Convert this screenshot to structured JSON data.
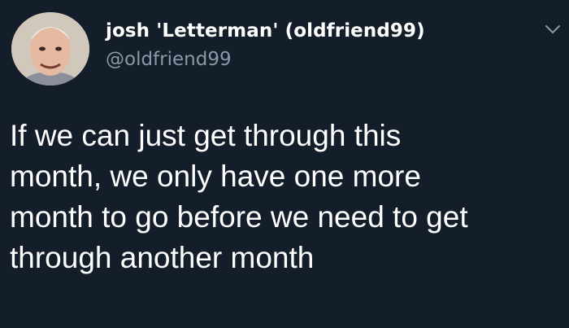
{
  "author": {
    "display_name": "josh 'Letterman' (oldfriend99)",
    "handle": "@oldfriend99",
    "avatar_icon": "profile-photo"
  },
  "menu_icon": "chevron-down-icon",
  "tweet": {
    "lines": [
      "If we can just get through this",
      "month, we only have one more",
      "month to go before we need to get",
      "through another month"
    ]
  },
  "colors": {
    "background": "#141d2a",
    "text": "#ffffff",
    "handle": "#8b98a5"
  }
}
